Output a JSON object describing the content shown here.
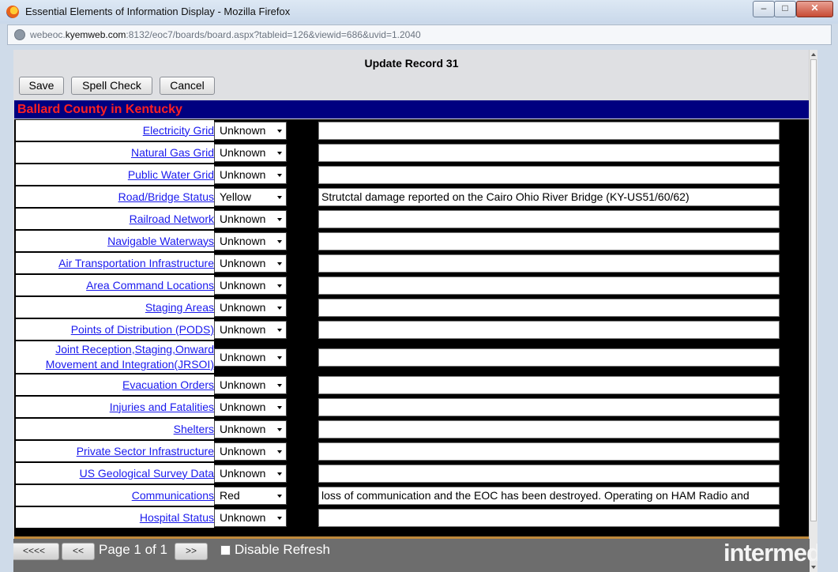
{
  "window": {
    "title": "Essential Elements of Information Display - Mozilla Firefox"
  },
  "address": {
    "host": "webeoc.kyemweb.com",
    "prefix": "webeoc.",
    "host_bold": "kyemweb.com",
    "rest": ":8132/eoc7/boards/board.aspx?tableid=126&viewid=686&uvid=1.2040"
  },
  "form": {
    "title": "Update Record 31",
    "buttons": {
      "save": "Save",
      "spell_check": "Spell Check",
      "cancel": "Cancel"
    },
    "section_header": "Ballard County in Kentucky",
    "rows": [
      {
        "label": "Electricity Grid",
        "status": "Unknown",
        "comment": ""
      },
      {
        "label": "Natural Gas Grid",
        "status": "Unknown",
        "comment": ""
      },
      {
        "label": "Public Water Grid",
        "status": "Unknown",
        "comment": ""
      },
      {
        "label": "Road/Bridge Status",
        "status": "Yellow",
        "comment": "Strutctal damage reported on the Cairo Ohio River Bridge (KY-US51/60/62)"
      },
      {
        "label": "Railroad Network",
        "status": "Unknown",
        "comment": ""
      },
      {
        "label": "Navigable Waterways",
        "status": "Unknown",
        "comment": ""
      },
      {
        "label": "Air Transportation Infrastructure",
        "status": "Unknown",
        "comment": ""
      },
      {
        "label": "Area Command Locations",
        "status": "Unknown",
        "comment": ""
      },
      {
        "label": "Staging Areas",
        "status": "Unknown",
        "comment": ""
      },
      {
        "label": "Points of Distribution (PODS)",
        "status": "Unknown",
        "comment": ""
      },
      {
        "label": "Joint Reception,Staging,Onward Movement and Integration(JRSOI)",
        "label_line1": "Joint Reception,Staging,Onward",
        "label_line2": "Movement and Integration(JRSOI)",
        "status": "Unknown",
        "comment": ""
      },
      {
        "label": "Evacuation Orders",
        "status": "Unknown",
        "comment": ""
      },
      {
        "label": "Injuries and Fatalities",
        "status": "Unknown",
        "comment": ""
      },
      {
        "label": "Shelters",
        "status": "Unknown",
        "comment": ""
      },
      {
        "label": "Private Sector Infrastructure",
        "status": "Unknown",
        "comment": ""
      },
      {
        "label": "US Geological Survey Data",
        "status": "Unknown",
        "comment": ""
      },
      {
        "label": "Communications",
        "status": "Red",
        "comment": "loss of communication and the EOC has been destroyed.  Operating on HAM Radio and"
      },
      {
        "label": "Hospital Status",
        "status": "Unknown",
        "comment": ""
      }
    ]
  },
  "pager": {
    "first": "<<<<",
    "prev": "<<",
    "page_info": "Page 1 of 1",
    "next": ">>",
    "disable_refresh": "Disable Refresh",
    "disable_refresh_checked": false
  },
  "branding": {
    "logo": "intermedix"
  },
  "colors": {
    "header_bg": "#000080",
    "header_text": "#ff2020",
    "link": "#1a1aee",
    "footer_bg": "#6d6d6d"
  }
}
